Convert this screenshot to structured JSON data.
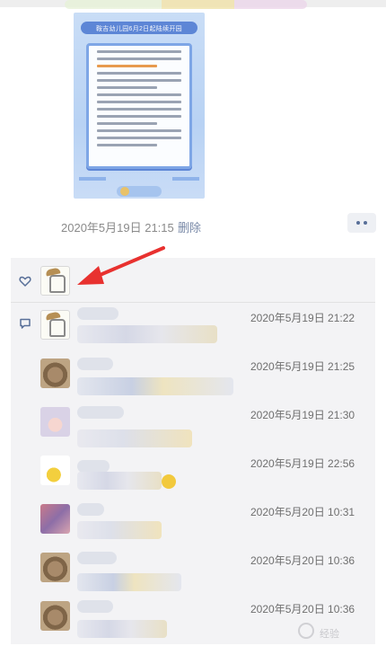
{
  "post": {
    "poster_title": "鞍吉幼儿园6月2日起陆续开园",
    "timestamp": "2020年5月19日 21:15",
    "delete_label": "删除"
  },
  "icons": {
    "like": "heart-outline-icon",
    "comment": "comment-bubble-icon",
    "more": "more-dots-icon"
  },
  "comments": [
    {
      "time": "2020年5月19日 21:22",
      "avatar": "sketch"
    },
    {
      "time": "2020年5月19日 21:25",
      "avatar": "cat"
    },
    {
      "time": "2020年5月19日 21:30",
      "avatar": "girl"
    },
    {
      "time": "2020年5月19日 22:56",
      "avatar": "duck"
    },
    {
      "time": "2020年5月20日 10:31",
      "avatar": "anime"
    },
    {
      "time": "2020年5月20日 10:36",
      "avatar": "cat"
    },
    {
      "time": "2020年5月20日 10:36",
      "avatar": "cat"
    }
  ],
  "watermark": "经验"
}
